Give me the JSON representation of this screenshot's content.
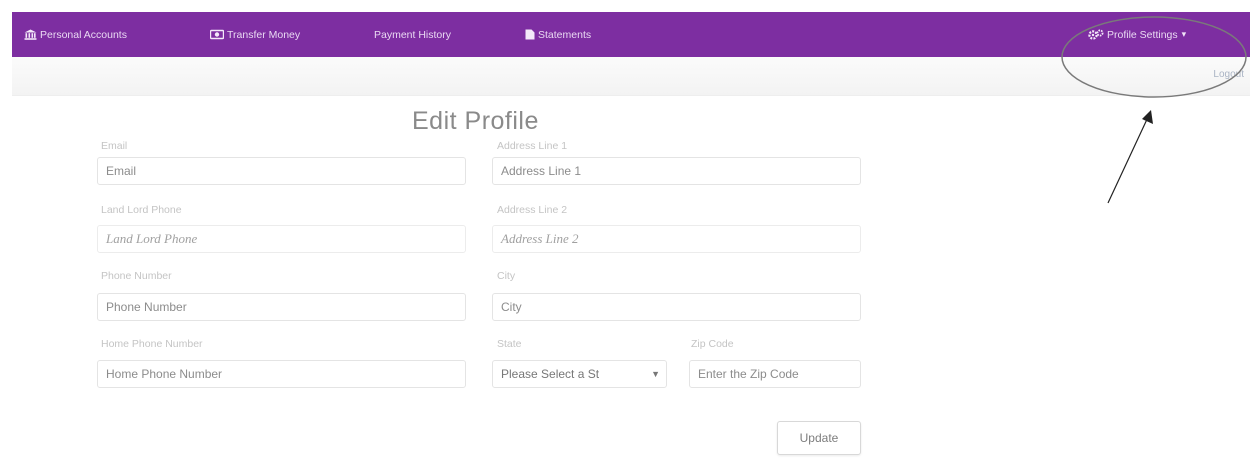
{
  "nav": {
    "items": [
      {
        "icon": "bank-icon",
        "label": "Personal Accounts"
      },
      {
        "icon": "money-icon",
        "label": "Transfer Money"
      },
      {
        "icon": "",
        "label": "Payment History"
      },
      {
        "icon": "document-icon",
        "label": "Statements"
      }
    ],
    "profile": {
      "icon": "gears-icon",
      "label": "Profile Settings"
    },
    "logout": "Logout"
  },
  "form": {
    "title": "Edit Profile",
    "email": {
      "label": "Email",
      "placeholder": "Email"
    },
    "address1": {
      "label": "Address Line 1",
      "placeholder": "Address Line 1"
    },
    "landlord": {
      "label": "Land Lord Phone",
      "placeholder": "Land Lord Phone"
    },
    "address2": {
      "label": "Address Line 2",
      "placeholder": "Address Line 2"
    },
    "phone": {
      "label": "Phone Number",
      "placeholder": "Phone Number"
    },
    "city": {
      "label": "City",
      "placeholder": "City"
    },
    "home_phone": {
      "label": "Home Phone Number",
      "placeholder": "Home Phone Number"
    },
    "state": {
      "label": "State",
      "selected": "Please Select a St"
    },
    "zip": {
      "label": "Zip Code",
      "placeholder": "Enter the Zip Code"
    },
    "update_label": "Update"
  },
  "colors": {
    "nav_bg": "#7d2ea1",
    "annotation": "#7a7a7a"
  }
}
